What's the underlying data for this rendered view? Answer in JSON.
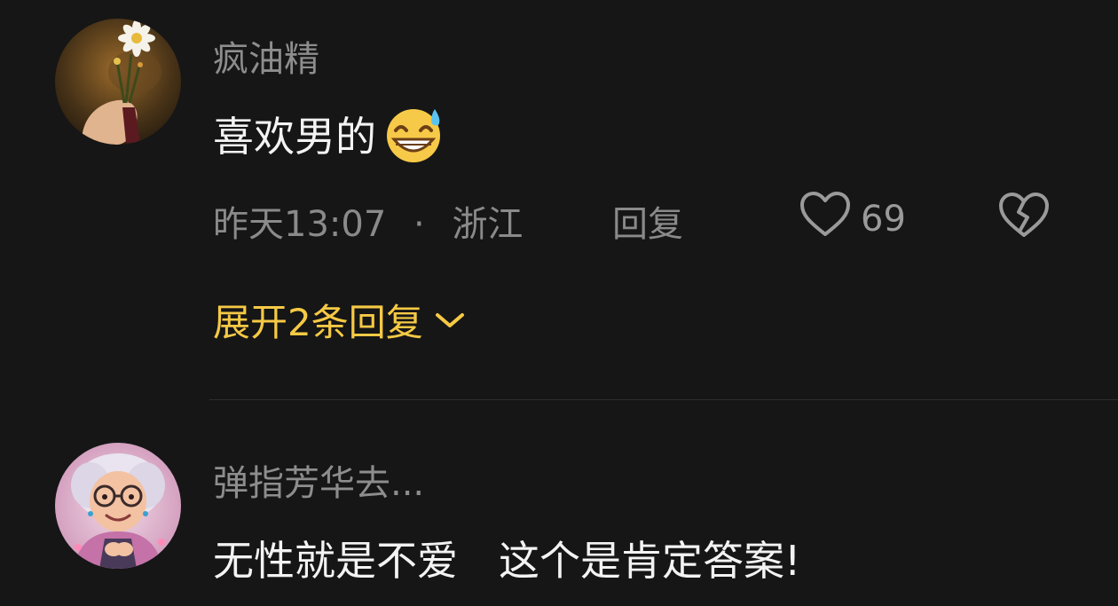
{
  "comments": [
    {
      "username": "疯油精",
      "text": "喜欢男的",
      "emoji": "grinning-sweat-emoji",
      "time": "昨天13:07",
      "separator": "·",
      "location": "浙江",
      "reply_label": "回复",
      "likes": "69",
      "expand_label": "展开2条回复"
    },
    {
      "username": "弹指芳华去...",
      "text": "无性就是不爱　这个是肯定答案!"
    }
  ],
  "colors": {
    "background": "#161616",
    "username": "#8d8d8d",
    "text": "#f3f3f3",
    "meta": "#8a8a8a",
    "accent": "#f6c945"
  },
  "icons": [
    "heart-outline-icon",
    "broken-heart-icon",
    "chevron-down-icon"
  ]
}
